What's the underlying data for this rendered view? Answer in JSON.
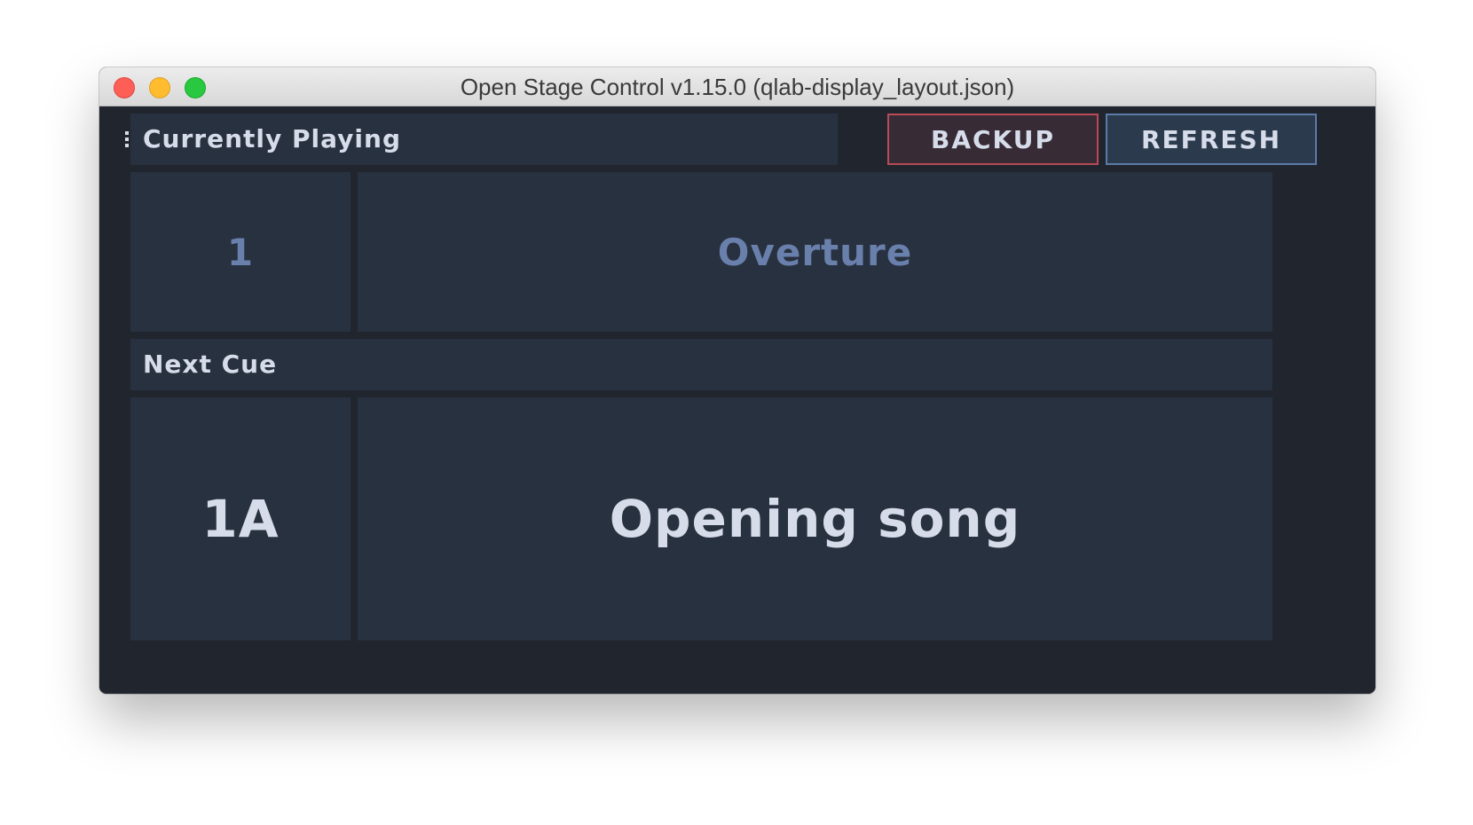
{
  "window": {
    "title": "Open Stage Control v1.15.0 (qlab-display_layout.json)"
  },
  "header": {
    "currently_playing_label": "Currently Playing",
    "backup_label": "BACKUP",
    "refresh_label": "REFRESH"
  },
  "current_cue": {
    "number": "1",
    "name": "Overture"
  },
  "next_section": {
    "label": "Next Cue"
  },
  "next_cue": {
    "number": "1A",
    "name": "Opening song"
  },
  "icons": {
    "drag_handle": "vertical-dots-icon"
  },
  "colors": {
    "background": "#21252e",
    "panel": "#28313f",
    "text": "#d6dcea",
    "current_text": "#6a80ac",
    "backup_border": "#b84b57",
    "refresh_border": "#5b7ba8"
  }
}
